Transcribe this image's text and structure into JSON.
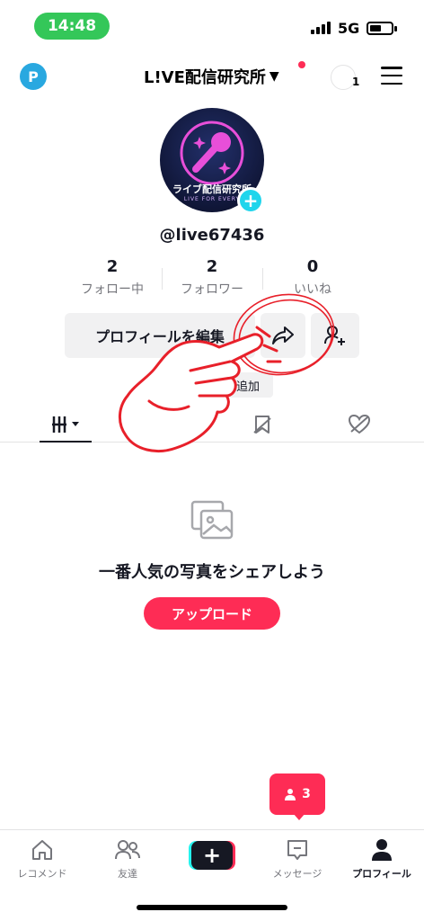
{
  "status_bar": {
    "time": "14:48",
    "network": "5G"
  },
  "header": {
    "account_name": "L!VE配信研究所",
    "story_count": "1",
    "logo_letter": "P"
  },
  "profile": {
    "avatar_text": "ライブ配信研究所",
    "avatar_subtext": "LIVE FOR EVERY",
    "username": "@live67436",
    "stats": [
      {
        "value": "2",
        "label": "フォロー中"
      },
      {
        "value": "2",
        "label": "フォロワー"
      },
      {
        "value": "0",
        "label": "いいね"
      }
    ],
    "edit_profile_label": "プロフィールを編集",
    "add_bio_plus": "+",
    "add_bio_label": "自己紹介を追加"
  },
  "empty_state": {
    "title": "一番人気の写真をシェアしよう",
    "upload_label": "アップロード"
  },
  "friend_bubble": {
    "count": "3"
  },
  "bottom_nav": [
    {
      "label": "レコメンド",
      "icon": "home-icon"
    },
    {
      "label": "友達",
      "icon": "friends-icon"
    },
    {
      "label": "",
      "icon": "create-icon"
    },
    {
      "label": "メッセージ",
      "icon": "inbox-icon"
    },
    {
      "label": "プロフィール",
      "icon": "profile-icon"
    }
  ],
  "colors": {
    "accent": "#fe2c55",
    "cyan": "#20d5ec",
    "status_green": "#34c759",
    "annotation_red": "#e8202a"
  }
}
